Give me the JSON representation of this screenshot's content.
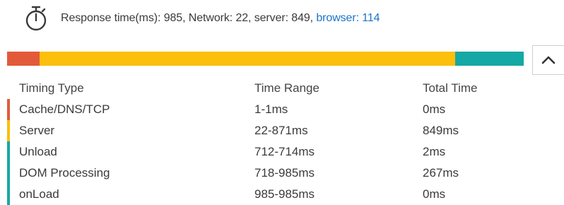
{
  "summary": {
    "prefix": "Response time(ms): 985, Network: 22, server: 849, ",
    "link": "browser: 114"
  },
  "colors": {
    "cache": "#e35a3a",
    "server": "#fbbf0c",
    "browser": "#16a8a4"
  },
  "bar": {
    "segments": [
      {
        "name": "cache",
        "fraction": 0.063
      },
      {
        "name": "server",
        "fraction": 0.8045
      },
      {
        "name": "browser",
        "fraction": 0.1325
      }
    ]
  },
  "table": {
    "headers": [
      "Timing Type",
      "Time Range",
      "Total Time"
    ],
    "rows": [
      {
        "type": "Cache/DNS/TCP",
        "range": "1-1ms",
        "total": "0ms",
        "color": "#e35a3a"
      },
      {
        "type": "Server",
        "range": "22-871ms",
        "total": "849ms",
        "color": "#fbbf0c"
      },
      {
        "type": "Unload",
        "range": "712-714ms",
        "total": "2ms",
        "color": "#16a8a4"
      },
      {
        "type": "DOM Processing",
        "range": "718-985ms",
        "total": "267ms",
        "color": "#16a8a4"
      },
      {
        "type": "onLoad",
        "range": "985-985ms",
        "total": "0ms",
        "color": "#16a8a4"
      }
    ]
  }
}
